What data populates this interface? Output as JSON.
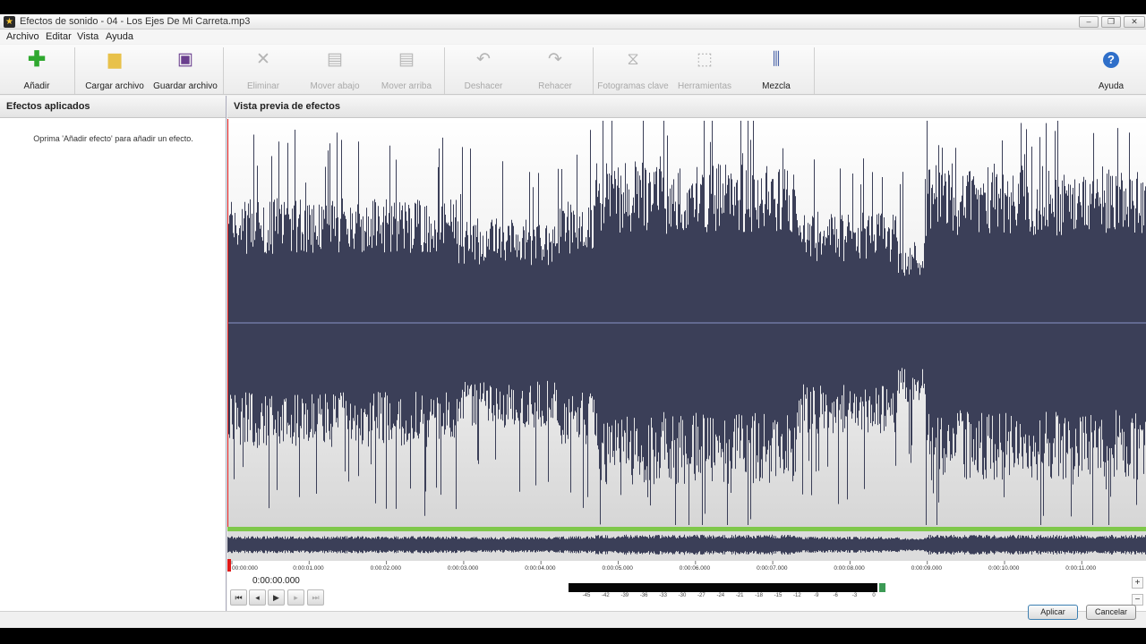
{
  "window": {
    "title": "Efectos de sonido - 04 - Los Ejes De Mi Carreta.mp3",
    "min_glyph": "–",
    "max_glyph": "❐",
    "close_glyph": "✕"
  },
  "menu": [
    "Archivo",
    "Editar",
    "Vista",
    "Ayuda"
  ],
  "toolbar": {
    "add": "Añadir",
    "load": "Cargar archivo",
    "save": "Guardar archivo",
    "delete": "Eliminar",
    "move_down": "Mover abajo",
    "move_up": "Mover arriba",
    "undo": "Deshacer",
    "redo": "Rehacer",
    "keyframes": "Fotogramas clave",
    "tools": "Herramientas",
    "mix": "Mezcla",
    "help": "Ayuda"
  },
  "left_pane": {
    "title": "Efectos aplicados",
    "hint": "Oprima 'Añadir efecto' para añadir un efecto."
  },
  "preview": {
    "title": "Vista previa de efectos",
    "time": "0:00:00.000",
    "timeline_labels": [
      "00:00:000",
      "0:00:01.000",
      "0:00:02.000",
      "0:00:03.000",
      "0:00:04.000",
      "0:00:05.000",
      "0:00:06.000",
      "0:00:07.000",
      "0:00:08.000",
      "0:00:09.000",
      "0:00:10.000",
      "0:00:11.000"
    ],
    "meter_labels": [
      "-45",
      "-42",
      "-39",
      "-36",
      "-33",
      "-30",
      "-27",
      "-24",
      "-21",
      "-18",
      "-15",
      "-12",
      "-9",
      "-6",
      "-3",
      "0"
    ]
  },
  "colors": {
    "waveform": "#3b3f58",
    "playhead": "#e01818",
    "overview_bar": "#7fc84a"
  },
  "buttons": {
    "apply": "Aplicar",
    "cancel": "Cancelar",
    "zoom_in": "+",
    "zoom_out": "−"
  }
}
